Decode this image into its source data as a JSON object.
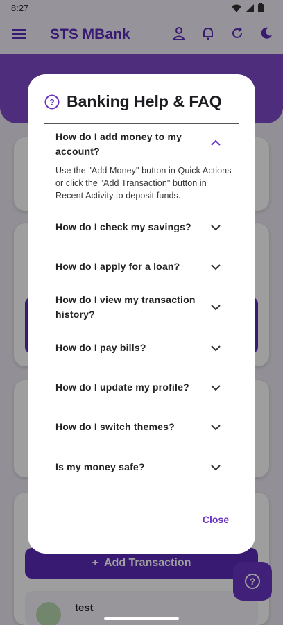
{
  "status_bar": {
    "time": "8:27"
  },
  "app_bar": {
    "title": "STS MBank"
  },
  "background": {
    "add_transaction_label": "Add Transaction",
    "recent_item_name": "test"
  },
  "dialog": {
    "title": "Banking Help & FAQ",
    "faqs": [
      {
        "question": "How do I add money to my account?",
        "expanded": true,
        "answer": "Use the \"Add Money\" button in Quick Actions or click the \"Add Transaction\" button in Recent Activity to deposit funds."
      },
      {
        "question": "How do I check my savings?",
        "expanded": false
      },
      {
        "question": "How do I apply for a loan?",
        "expanded": false
      },
      {
        "question": "How do I view my transaction history?",
        "expanded": false
      },
      {
        "question": "How do I pay bills?",
        "expanded": false
      },
      {
        "question": "How do I update my profile?",
        "expanded": false
      },
      {
        "question": "How do I switch themes?",
        "expanded": false
      },
      {
        "question": "Is my money safe?",
        "expanded": false
      }
    ],
    "close_label": "Close"
  },
  "colors": {
    "primary": "#5b2bb8",
    "accent": "#6a35c5"
  }
}
